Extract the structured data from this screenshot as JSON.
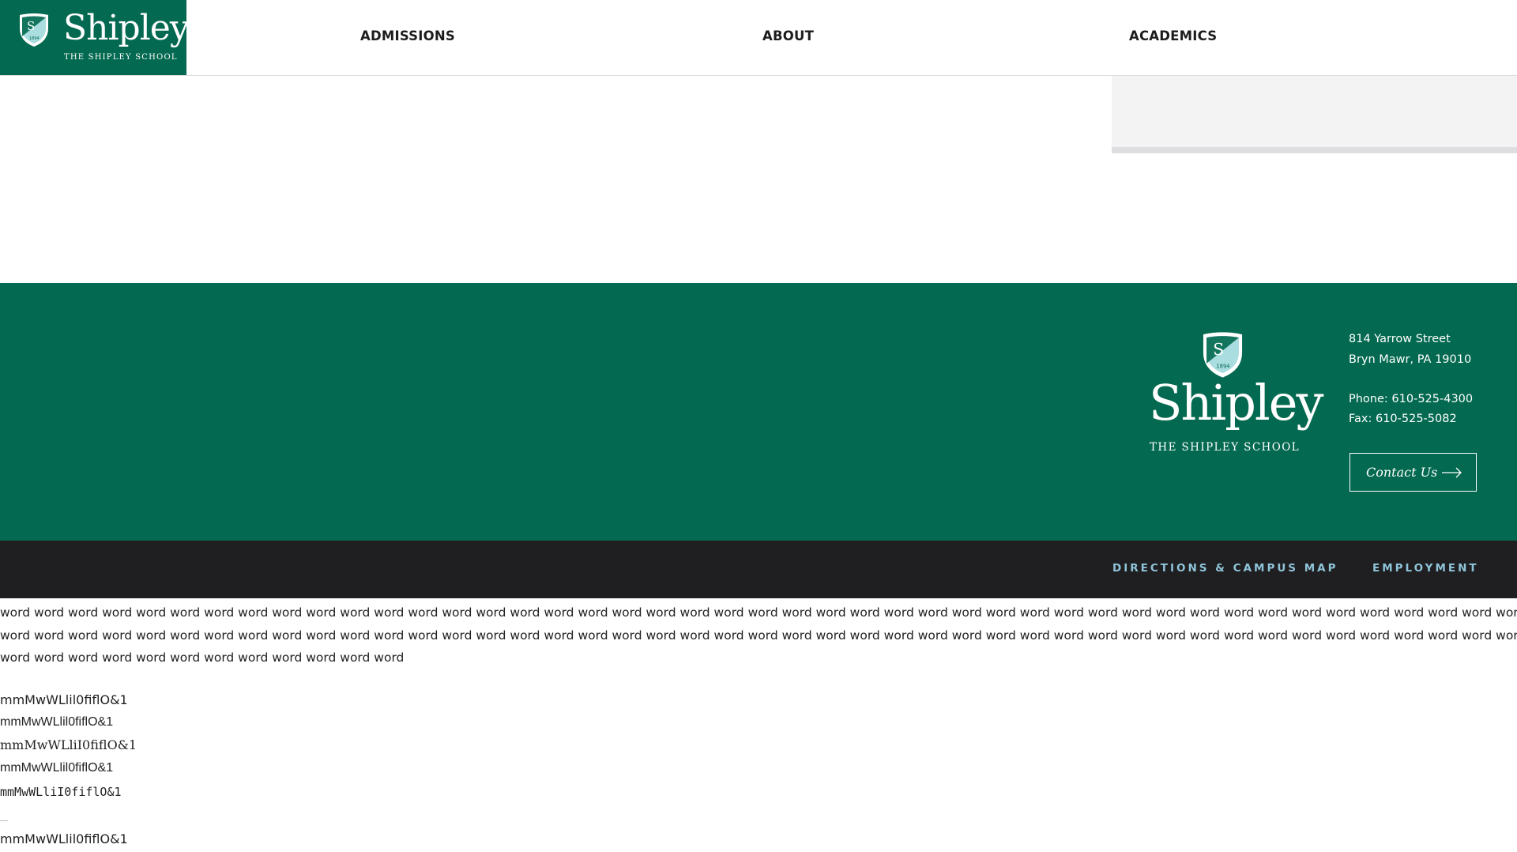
{
  "header": {
    "logo_word": "Shipley",
    "logo_sub": "THE SHIPLEY SCHOOL",
    "nav": [
      "ADMISSIONS",
      "ABOUT",
      "ACADEMICS"
    ]
  },
  "footer": {
    "logo_word": "Shipley",
    "logo_sub": "THE SHIPLEY SCHOOL",
    "address_line1": "814 Yarrow Street",
    "address_line2": "Bryn Mawr, PA 19010",
    "phone": "Phone: 610-525-4300",
    "fax": "Fax: 610-525-5082",
    "contact_label": "Contact Us",
    "bar_links": [
      "DIRECTIONS & CAMPUS MAP",
      "EMPLOYMENT"
    ]
  },
  "test_text": {
    "words_line1": "word word word word word word word word word word word word word word word word word word word word word word word word word word word word word word word word word word word word word word word word word word word word word word word word word",
    "words_line2": "word word word word word word word word word word word word word word word word word word word word word word word word word word word word word word word word word word word word word word word word word word word word word word word word word",
    "words_line3": "word word word word word word word word word word word word",
    "samples": [
      "mmMwWLlil0fiflO&1",
      "mmMwWLlil0fiflO&1",
      "mmMwWLliI0fiflO&1",
      "mmMwWLlil0fiflO&1",
      "mmMwWLliI0fiflO&1",
      "mmMwWLlil0fiflO&1"
    ]
  },
  "colors": {
    "brand_green": "#036950",
    "crest_light": "#a9dde0",
    "bar_dark": "#1f1f21",
    "bar_link": "#8fc4d9"
  }
}
